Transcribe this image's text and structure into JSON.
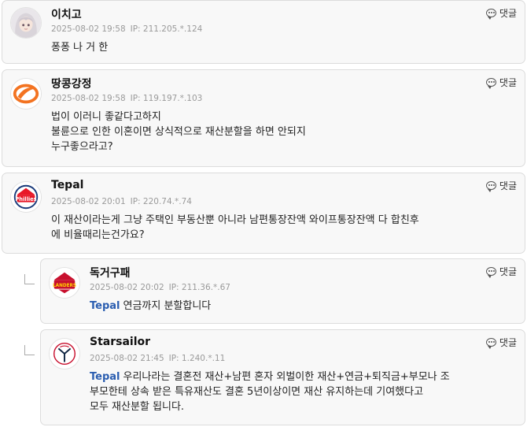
{
  "reply_label": "댓글",
  "comments": [
    {
      "nickname": "이치고",
      "date": "2025-08-02 19:58",
      "ip": "IP: 211.205.*.124",
      "lines": [
        "퐁퐁 나 거 한"
      ],
      "avatar_icon": "anime-girl-avatar-icon"
    },
    {
      "nickname": "땅콩강정",
      "date": "2025-08-02 19:58",
      "ip": "IP: 119.197.*.103",
      "lines": [
        "법이 이러니 좋같다고하지",
        "불륜으로 인한 이혼이면 상식적으로 재산분할을 하면 안되지",
        "누구좋으라고?"
      ],
      "avatar_icon": "hanwha-eagles-logo-icon"
    },
    {
      "nickname": "Tepal",
      "date": "2025-08-02 20:01",
      "ip": "IP: 220.74.*.74",
      "lines": [
        "이 재산이라는게 그냥 주택인 부동산뿐 아니라 남편통장잔액 와이프통장잔액 다 합친후",
        "에 비율때리는건가요?"
      ],
      "avatar_icon": "phillies-logo-icon"
    },
    {
      "nickname": "독거구패",
      "date": "2025-08-02 20:02",
      "ip": "IP: 211.36.*.67",
      "mention": "Tepal",
      "lines": [
        "연금까지 분할합니다"
      ],
      "avatar_icon": "landers-logo-icon"
    },
    {
      "nickname": "Starsailor",
      "date": "2025-08-02 21:45",
      "ip": "IP: 1.240.*.11",
      "mention": "Tepal",
      "lines": [
        "우리나라는 결혼전 재산+남편 혼자 외벌이한 재산+연금+퇴직금+부모나 조",
        "부모한테 상속 받은 특유재산도 결혼 5년이상이면 재산 유지하는데 기여했다고",
        "모두 재산분할 됩니다."
      ],
      "avatar_icon": "yankees-logo-icon"
    }
  ],
  "colors": {
    "card_bg": "#f8f8f8",
    "border": "#dcdcdc",
    "mention": "#2a5db0",
    "meta": "#9a9a9a"
  }
}
